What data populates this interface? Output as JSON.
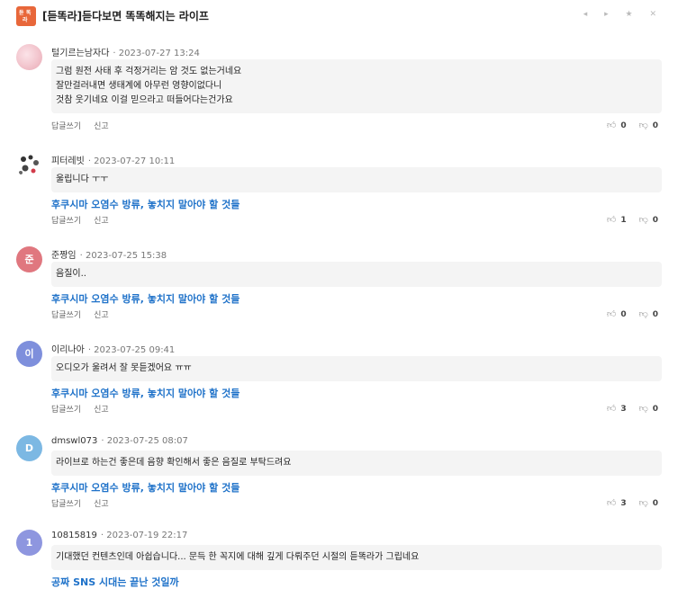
{
  "header": {
    "title": "[듣똑라]듣다보면 똑똑해지는 라이프",
    "logo_text": "듣똑라"
  },
  "action_labels": {
    "reply": "답글쓰기",
    "report": "신고"
  },
  "comments": [
    {
      "author": "털기르는남자다",
      "date": "· 2023-07-27 13:24",
      "avatar_text": "",
      "avatar_color": "#f3c7cf",
      "lines": [
        "그럼 원전 사태 후 걱정거리는 암 것도 없는거네요",
        "잘만걸러내면 생태계에 아무런 영향이없다니",
        "것참 웃기네요 이걸 믿으라고 떠들어다는건가요"
      ],
      "link": "",
      "likes": "0",
      "dislikes": "0"
    },
    {
      "author": "피터레빗",
      "date": "· 2023-07-27 10:11",
      "avatar_text": "",
      "avatar_color": "#e8e8e8",
      "lines": [
        "울립니다 ㅜㅜ"
      ],
      "link": "후쿠시마 오염수 방류, 놓치지 말아야 할 것들",
      "likes": "1",
      "dislikes": "0"
    },
    {
      "author": "준짱임",
      "date": "· 2023-07-25 15:38",
      "avatar_text": "준",
      "avatar_color": "#e0777f",
      "lines": [
        "음질이.."
      ],
      "link": "후쿠시마 오염수 방류, 놓치지 말아야 할 것들",
      "likes": "0",
      "dislikes": "0"
    },
    {
      "author": "이리나아",
      "date": "· 2023-07-25 09:41",
      "avatar_text": "이",
      "avatar_color": "#7e8fdc",
      "lines": [
        "오디오가 울려서 잘 못듣겠어요 ㅠㅠ"
      ],
      "link": "후쿠시마 오염수 방류, 놓치지 말아야 할 것들",
      "likes": "3",
      "dislikes": "0"
    },
    {
      "author": "dmswl073",
      "date": "· 2023-07-25 08:07",
      "avatar_text": "D",
      "avatar_color": "#7cb8e3",
      "lines": [
        "라이브로 하는건 좋은데 음향 확인해서 좋은 음질로 부탁드려요"
      ],
      "link": "후쿠시마 오염수 방류, 놓치지 말아야 할 것들",
      "likes": "3",
      "dislikes": "0"
    },
    {
      "author": "10815819",
      "date": "· 2023-07-19 22:17",
      "avatar_text": "1",
      "avatar_color": "#8e96df",
      "lines": [
        "기대했던 컨텐츠인데 아쉽습니다... 문득 한 꼭지에 대해 깊게 다뤄주던 시절의 듣똑라가 그립네요"
      ],
      "link": "공짜 SNS 시대는 끝난 것일까",
      "likes": "",
      "dislikes": ""
    }
  ]
}
